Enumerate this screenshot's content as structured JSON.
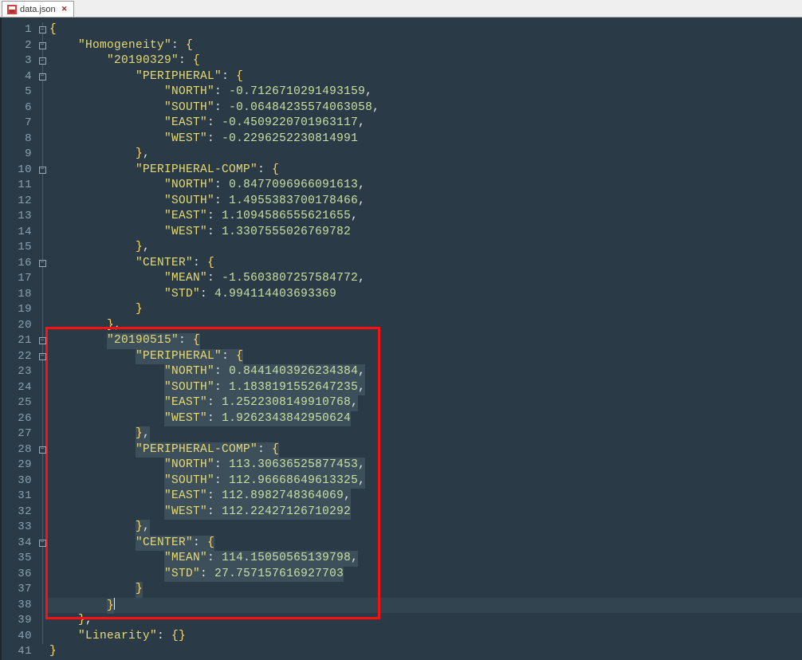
{
  "tab": {
    "filename": "data.json",
    "close_glyph": "✕"
  },
  "highlight_box": {
    "top_line": 21,
    "bottom_line": 38
  },
  "cursor_line": 38,
  "line_count": 41,
  "json_text": {
    "root_open": "{",
    "root_close": "}",
    "homogeneity_key": "\"Homogeneity\"",
    "linearity_key": "\"Linearity\"",
    "linearity_value": "{}",
    "date1_key": "\"20190329\"",
    "date2_key": "\"20190515\"",
    "peripheral_key": "\"PERIPHERAL\"",
    "peripheral_comp_key": "\"PERIPHERAL-COMP\"",
    "center_key": "\"CENTER\"",
    "north_key": "\"NORTH\"",
    "south_key": "\"SOUTH\"",
    "east_key": "\"EAST\"",
    "west_key": "\"WEST\"",
    "mean_key": "\"MEAN\"",
    "std_key": "\"STD\"",
    "d1_peripheral_north": "-0.7126710291493159",
    "d1_peripheral_south": "-0.06484235574063058",
    "d1_peripheral_east": "-0.4509220701963117",
    "d1_peripheral_west": "-0.2296252230814991",
    "d1_pcomp_north": "0.8477096966091613",
    "d1_pcomp_south": "1.4955383700178466",
    "d1_pcomp_east": "1.1094586555621655",
    "d1_pcomp_west": "1.3307555026769782",
    "d1_center_mean": "-1.5603807257584772",
    "d1_center_std": "4.994114403693369",
    "d2_peripheral_north": "0.8441403926234384",
    "d2_peripheral_south": "1.1838191552647235",
    "d2_peripheral_east": "1.2522308149910768",
    "d2_peripheral_west": "1.9262343842950624",
    "d2_pcomp_north": "113.30636525877453",
    "d2_pcomp_south": "112.96668649613325",
    "d2_pcomp_east": "112.8982748364069",
    "d2_pcomp_west": "112.22427126710292",
    "d2_center_mean": "114.15050565139798",
    "d2_center_std": "27.757157616927703"
  }
}
